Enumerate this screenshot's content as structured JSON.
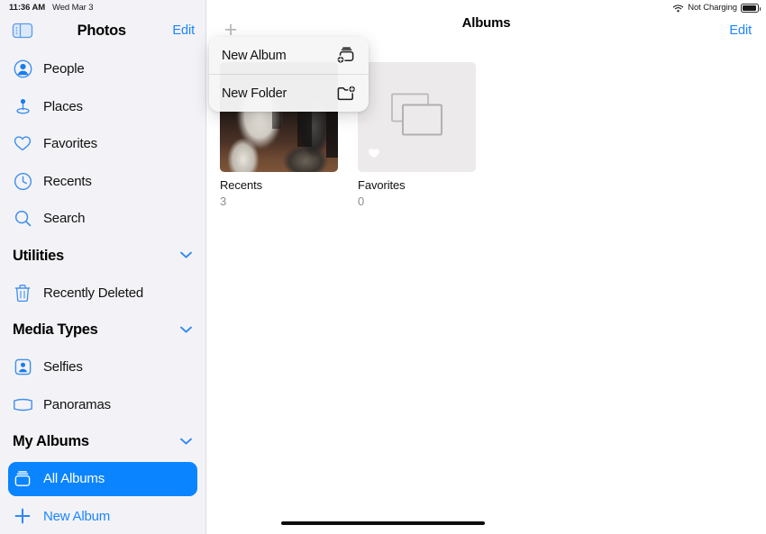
{
  "status_bar": {
    "time": "11:36 AM",
    "date": "Wed Mar 3",
    "charging_label": "Not Charging",
    "wifi_icon": "wifi-icon",
    "battery_icon": "battery-icon"
  },
  "sidebar": {
    "toggle_icon": "sidebar-toggle-icon",
    "title": "Photos",
    "edit_label": "Edit",
    "items": [
      {
        "label": "People",
        "icon": "person-circle-icon"
      },
      {
        "label": "Places",
        "icon": "map-pin-icon"
      },
      {
        "label": "Favorites",
        "icon": "heart-icon"
      },
      {
        "label": "Recents",
        "icon": "clock-icon"
      },
      {
        "label": "Search",
        "icon": "magnifier-icon"
      }
    ],
    "sections": [
      {
        "title": "Utilities",
        "chevron_icon": "chevron-down-icon",
        "items": [
          {
            "label": "Recently Deleted",
            "icon": "trash-icon"
          }
        ]
      },
      {
        "title": "Media Types",
        "chevron_icon": "chevron-down-icon",
        "items": [
          {
            "label": "Selfies",
            "icon": "selfie-icon"
          },
          {
            "label": "Panoramas",
            "icon": "panorama-icon"
          }
        ]
      },
      {
        "title": "My Albums",
        "chevron_icon": "chevron-down-icon",
        "items": [
          {
            "label": "All Albums",
            "icon": "albums-stack-icon",
            "selected": true
          },
          {
            "label": "New Album",
            "icon": "plus-icon",
            "action": true
          }
        ]
      }
    ]
  },
  "navbar": {
    "add_icon": "plus-icon",
    "add_label": "+",
    "title": "Albums",
    "edit_label": "Edit"
  },
  "menu": {
    "items": [
      {
        "label": "New Album",
        "icon": "rectangle-stack-badge-plus-icon"
      },
      {
        "label": "New Folder",
        "icon": "folder-badge-plus-icon"
      }
    ]
  },
  "albums": [
    {
      "name": "Recents",
      "count": "3",
      "thumb_type": "photo"
    },
    {
      "name": "Favorites",
      "count": "0",
      "thumb_type": "placeholder",
      "badge_icon": "heart-icon"
    }
  ],
  "colors": {
    "accent_blue": "#0a84ff",
    "sidebar_bg": "#f3f3f7",
    "selected_pill": "#0a84ff",
    "placeholder_gray": "#eceaea",
    "secondary_text": "#8d8d92"
  },
  "home_indicator": "home-indicator"
}
